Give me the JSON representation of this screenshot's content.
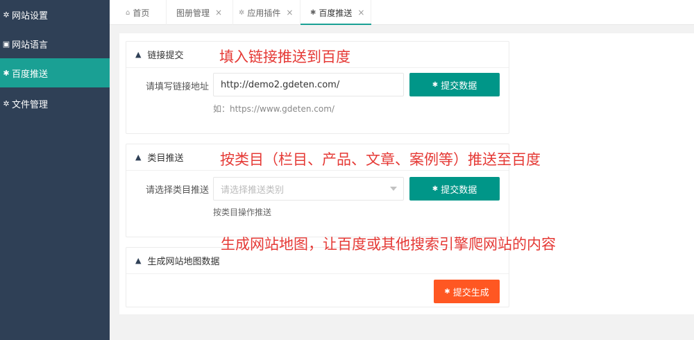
{
  "sidebar": {
    "items": [
      {
        "icon": "gears-icon",
        "glyph": "✲",
        "label": "网站设置"
      },
      {
        "icon": "language-icon",
        "glyph": "▣",
        "label": "网站语言"
      },
      {
        "icon": "bug-icon",
        "glyph": "✱",
        "label": "百度推送"
      },
      {
        "icon": "gear-icon",
        "glyph": "✲",
        "label": "文件管理"
      }
    ],
    "active_index": 2
  },
  "tabs": [
    {
      "label": "首页",
      "icon": "home-icon",
      "glyph": "⌂",
      "closable": false
    },
    {
      "label": "图册管理",
      "closable": true
    },
    {
      "label": "应用插件",
      "icon": "gear-icon",
      "glyph": "✲",
      "closable": true
    },
    {
      "label": "百度推送",
      "icon": "bug-icon",
      "glyph": "✱",
      "closable": true,
      "active": true
    }
  ],
  "close_glyph": "×",
  "panels": {
    "link_submit": {
      "title": "链接提交",
      "field_label": "请填写链接地址",
      "input_value": "http://demo2.gdeten.com/",
      "hint": "如：https://www.gdeten.com/",
      "button": "提交数据"
    },
    "category_push": {
      "title": "类目推送",
      "field_label": "请选择类目推送",
      "select_placeholder": "请选择推送类别",
      "hint": "按类目操作推送",
      "button": "提交数据"
    },
    "sitemap": {
      "title": "生成网站地图数据",
      "button": "提交生成"
    }
  },
  "annotations": {
    "link": "填入链接推送到百度",
    "category": "按类目（栏目、产品、文章、案例等）推送至百度",
    "sitemap": "生成网站地图，让百度或其他搜索引擎爬网站的内容"
  },
  "colors": {
    "sidebar_bg": "#2f4056",
    "sidebar_active": "#1aa094",
    "primary_button": "#009688",
    "generate_button": "#ff5722",
    "annotation_text": "#e53935"
  }
}
